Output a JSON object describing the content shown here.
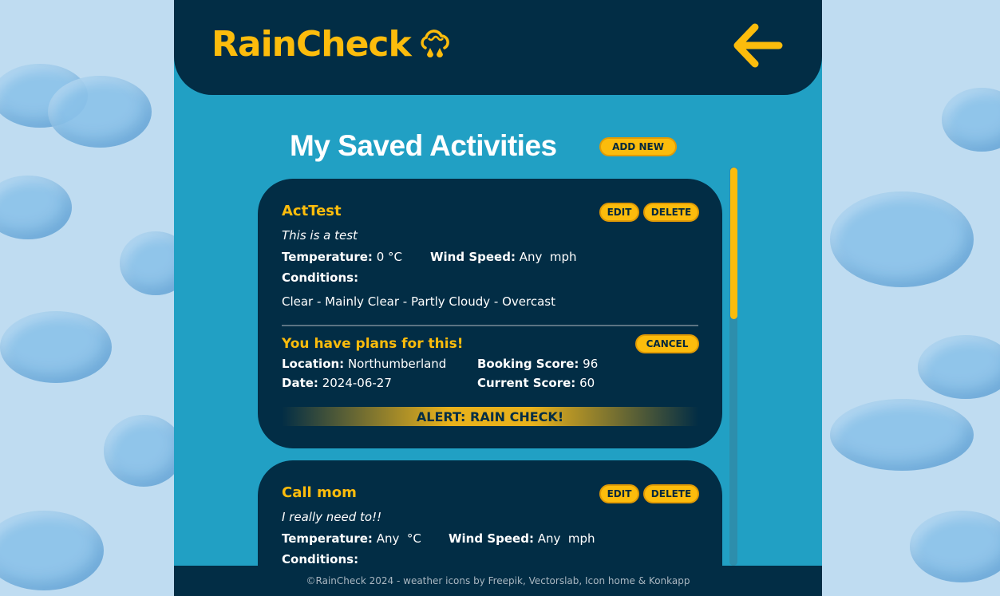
{
  "header": {
    "logo_text": "RainCheck",
    "logo_icon": "rain-cloud-icon",
    "back_icon": "arrow-left-icon"
  },
  "main": {
    "title": "My Saved Activities",
    "add_new_label": "ADD NEW"
  },
  "activities": [
    {
      "name": "ActTest",
      "edit_label": "EDIT",
      "delete_label": "DELETE",
      "description": "This is a test",
      "temperature_label": "Temperature:",
      "temperature_value": "0 °C",
      "wind_label": "Wind Speed:",
      "wind_value": "Any  mph",
      "conditions_label": "Conditions:",
      "conditions_value": "Clear - Mainly Clear - Partly Cloudy - Overcast",
      "plan": {
        "title": "You have plans for this!",
        "cancel_label": "CANCEL",
        "location_label": "Location:",
        "location_value": "Northumberland",
        "date_label": "Date:",
        "date_value": "2024-06-27",
        "booking_label": "Booking Score:",
        "booking_value": "96",
        "current_label": "Current Score:",
        "current_value": "60",
        "alert": "ALERT: RAIN CHECK!"
      }
    },
    {
      "name": "Call mom",
      "edit_label": "EDIT",
      "delete_label": "DELETE",
      "description": "I really need to!!",
      "temperature_label": "Temperature:",
      "temperature_value": "Any  °C",
      "wind_label": "Wind Speed:",
      "wind_value": "Any  mph",
      "conditions_label": "Conditions:"
    }
  ],
  "footer": {
    "text": "©RainCheck 2024 - weather icons by Freepik, Vectorslab, Icon home & Konkapp"
  },
  "colors": {
    "accent": "#fcbc0c",
    "navy": "#022d45",
    "teal": "#21a0c4"
  }
}
